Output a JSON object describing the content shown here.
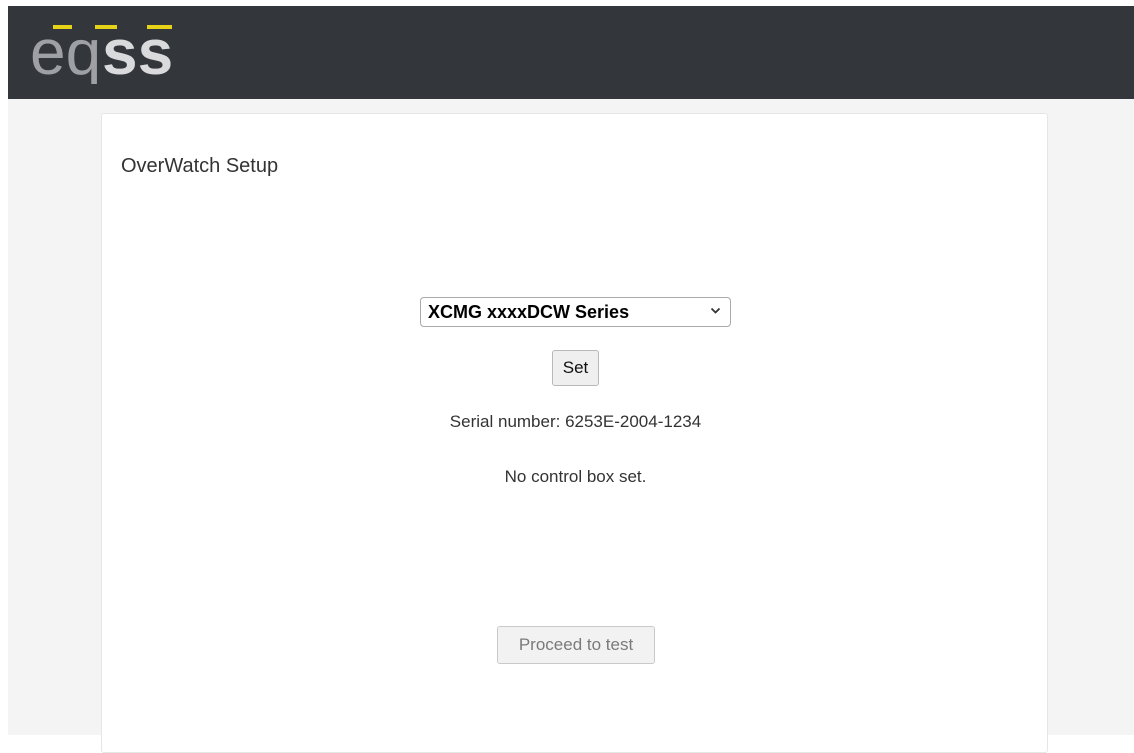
{
  "header": {
    "logo": {
      "icon": "eqss-logo",
      "text": "eqss",
      "colors": {
        "light": "#9ea0a4",
        "dark": "#d9dadc",
        "accent": "#e6d318"
      }
    },
    "background_color": "#33363b"
  },
  "page": {
    "title": "OverWatch Setup"
  },
  "model_select": {
    "selected": "XCMG xxxxDCW Series",
    "icon": "chevron-down-icon"
  },
  "set_button": {
    "label": "Set"
  },
  "serial": {
    "text": "Serial number: 6253E-2004-1234"
  },
  "status": {
    "text": "No control box set."
  },
  "proceed_button": {
    "label": "Proceed to test",
    "disabled": true
  }
}
